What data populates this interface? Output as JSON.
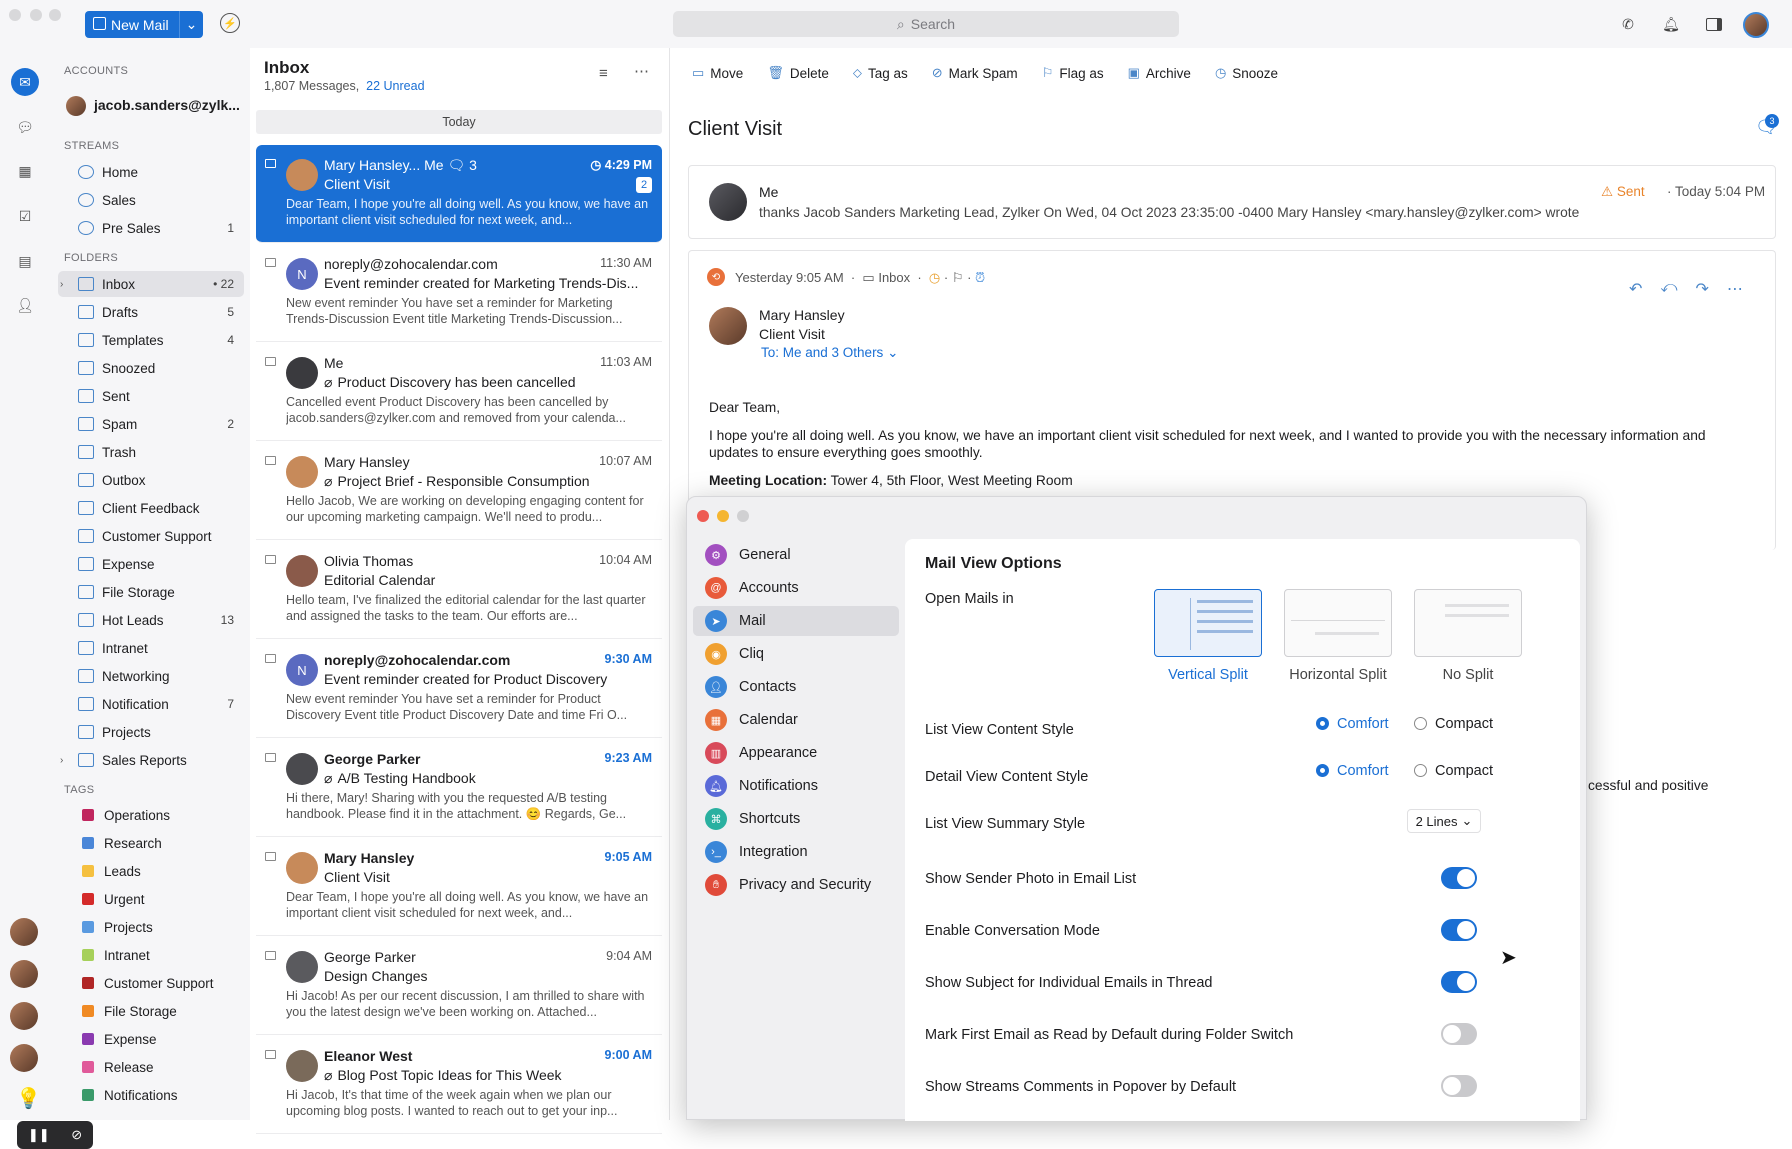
{
  "topbar": {
    "new_mail": "New Mail",
    "search_placeholder": "Search"
  },
  "folders_panel": {
    "accounts_label": "ACCOUNTS",
    "account": "jacob.sanders@zylk...",
    "streams_label": "STREAMS",
    "streams": [
      {
        "label": "Home",
        "count": ""
      },
      {
        "label": "Sales",
        "count": ""
      },
      {
        "label": "Pre Sales",
        "count": "1"
      }
    ],
    "folders_label": "FOLDERS",
    "folders": [
      {
        "label": "Inbox",
        "count": "• 22"
      },
      {
        "label": "Drafts",
        "count": "5"
      },
      {
        "label": "Templates",
        "count": "4"
      },
      {
        "label": "Snoozed",
        "count": ""
      },
      {
        "label": "Sent",
        "count": ""
      },
      {
        "label": "Spam",
        "count": "2"
      },
      {
        "label": "Trash",
        "count": ""
      },
      {
        "label": "Outbox",
        "count": ""
      },
      {
        "label": "Client Feedback",
        "count": ""
      },
      {
        "label": "Customer Support",
        "count": ""
      },
      {
        "label": "Expense",
        "count": ""
      },
      {
        "label": "File Storage",
        "count": ""
      },
      {
        "label": "Hot Leads",
        "count": "13"
      },
      {
        "label": "Intranet",
        "count": ""
      },
      {
        "label": "Networking",
        "count": ""
      },
      {
        "label": "Notification",
        "count": "7"
      },
      {
        "label": "Projects",
        "count": ""
      },
      {
        "label": "Sales Reports",
        "count": ""
      }
    ],
    "tags_label": "TAGS",
    "tags": [
      {
        "label": "Operations",
        "color": "#c0265e"
      },
      {
        "label": "Research",
        "color": "#4a86d8"
      },
      {
        "label": "Leads",
        "color": "#f5c040"
      },
      {
        "label": "Urgent",
        "color": "#d42a2a"
      },
      {
        "label": "Projects",
        "color": "#5a9ae0"
      },
      {
        "label": "Intranet",
        "color": "#a6d05a"
      },
      {
        "label": "Customer Support",
        "color": "#b02626"
      },
      {
        "label": "File Storage",
        "color": "#f08a24"
      },
      {
        "label": "Expense",
        "color": "#8a3ab0"
      },
      {
        "label": "Release",
        "color": "#e05a9a"
      },
      {
        "label": "Notifications",
        "color": "#3a9a6a"
      }
    ]
  },
  "inbox": {
    "title": "Inbox",
    "messages_count": "1,807 Messages,",
    "unread": "22 Unread",
    "group": "Today",
    "messages": [
      {
        "from": "Mary Hansley... Me",
        "thread": "3",
        "subject": "Client Visit",
        "badge": "2",
        "time": "4:29 PM",
        "preview": "Dear Team, I hope you're all doing well. As you know, we have an important client visit scheduled for next week, and..."
      },
      {
        "from": "noreply@zohocalendar.com",
        "subject": "Event reminder created for Marketing Trends-Dis...",
        "time": "11:30 AM",
        "preview": "New event reminder You have set a reminder for Marketing Trends-Discussion Event title Marketing Trends-Discussion..."
      },
      {
        "from": "Me",
        "subject": "Product Discovery has been cancelled",
        "time": "11:03 AM",
        "preview": "Cancelled event Product Discovery has been cancelled by jacob.sanders@zylker.com and removed from your calenda..."
      },
      {
        "from": "Mary Hansley",
        "subject": "Project Brief - Responsible Consumption",
        "time": "10:07 AM",
        "preview": "Hello Jacob, We are working on developing engaging content for our upcoming marketing campaign. We'll need to produ..."
      },
      {
        "from": "Olivia Thomas",
        "subject": "Editorial Calendar",
        "time": "10:04 AM",
        "preview": "Hello team, I've finalized the editorial calendar for the last quarter and assigned the tasks to the team. Our efforts are..."
      },
      {
        "from": "noreply@zohocalendar.com",
        "subject": "Event reminder created for Product Discovery",
        "time": "9:30 AM",
        "preview": "New event reminder You have set a reminder for Product Discovery Event title Product Discovery Date and time Fri O..."
      },
      {
        "from": "George Parker",
        "subject": "A/B Testing Handbook",
        "time": "9:23 AM",
        "preview": "Hi there, Mary! Sharing with you the requested A/B testing handbook. Please find it in the attachment. 😊 Regards, Ge..."
      },
      {
        "from": "Mary Hansley",
        "subject": "Client Visit",
        "time": "9:05 AM",
        "preview": "Dear Team, I hope you're all doing well. As you know, we have an important client visit scheduled for next week, and..."
      },
      {
        "from": "George Parker",
        "subject": "Design Changes",
        "time": "9:04 AM",
        "preview": "Hi Jacob! As per our recent discussion, I am thrilled to share with you the latest design we've been working on. Attached..."
      },
      {
        "from": "Eleanor West",
        "subject": "Blog Post Topic Ideas for This Week",
        "time": "9:00 AM",
        "preview": "Hi Jacob, It's that time of the week again when we plan our upcoming blog posts. I wanted to reach out to get your inp..."
      }
    ]
  },
  "toolbar": [
    "Move",
    "Delete",
    "Tag as",
    "Mark Spam",
    "Flag as",
    "Archive",
    "Snooze"
  ],
  "reader": {
    "subject": "Client Visit",
    "comments_badge": "3",
    "sent_card": {
      "from": "Me",
      "status": "Sent",
      "time": "Today 5:04 PM",
      "snippet": "thanks Jacob Sanders Marketing Lead, Zylker  On Wed, 04 Oct 2023 23:35:00 -0400 Mary Hansley <mary.hansley@zylker.com> wrote"
    },
    "mail": {
      "meta_time": "Yesterday 9:05 AM",
      "meta_folder": "Inbox",
      "from": "Mary Hansley",
      "subject": "Client Visit",
      "to": "To: Me and 3 Others",
      "greeting": "Dear Team,",
      "para1": "I hope you're all doing well. As you know, we have an important client visit scheduled for next week, and I wanted to provide you with the necessary information and updates to ensure everything goes smoothly.",
      "location_label": "Meeting Location:",
      "location": "Tower 4, 5th Floor, West Meeting Room",
      "trailing": "cessful and positive"
    }
  },
  "settings": {
    "menu": [
      {
        "label": "General",
        "color": "#a24fc0"
      },
      {
        "label": "Accounts",
        "color": "#e85a3a"
      },
      {
        "label": "Mail",
        "color": "#3a86d8"
      },
      {
        "label": "Cliq",
        "color": "#f0a030"
      },
      {
        "label": "Contacts",
        "color": "#3a86d8"
      },
      {
        "label": "Calendar",
        "color": "#e8703a"
      },
      {
        "label": "Appearance",
        "color": "#d84a5a"
      },
      {
        "label": "Notifications",
        "color": "#5a6ad8"
      },
      {
        "label": "Shortcuts",
        "color": "#2ab0a0"
      },
      {
        "label": "Integration",
        "color": "#3a86d8"
      },
      {
        "label": "Privacy and Security",
        "color": "#e04a3a"
      }
    ],
    "title": "Mail View Options",
    "open_mails_in": "Open Mails in",
    "layouts": [
      "Vertical Split",
      "Horizontal Split",
      "No Split"
    ],
    "list_view_content_style": "List View Content Style",
    "detail_view_content_style": "Detail View Content Style",
    "comfort": "Comfort",
    "compact": "Compact",
    "list_view_summary_style": "List View Summary Style",
    "summary_value": "2 Lines",
    "toggles": [
      {
        "label": "Show Sender Photo in Email List",
        "on": true
      },
      {
        "label": "Enable Conversation Mode",
        "on": true
      },
      {
        "label": "Show Subject for Individual Emails in Thread",
        "on": true
      },
      {
        "label": "Mark First Email as Read by Default during Folder Switch",
        "on": false
      },
      {
        "label": "Show Streams Comments in Popover by Default",
        "on": false
      }
    ]
  }
}
